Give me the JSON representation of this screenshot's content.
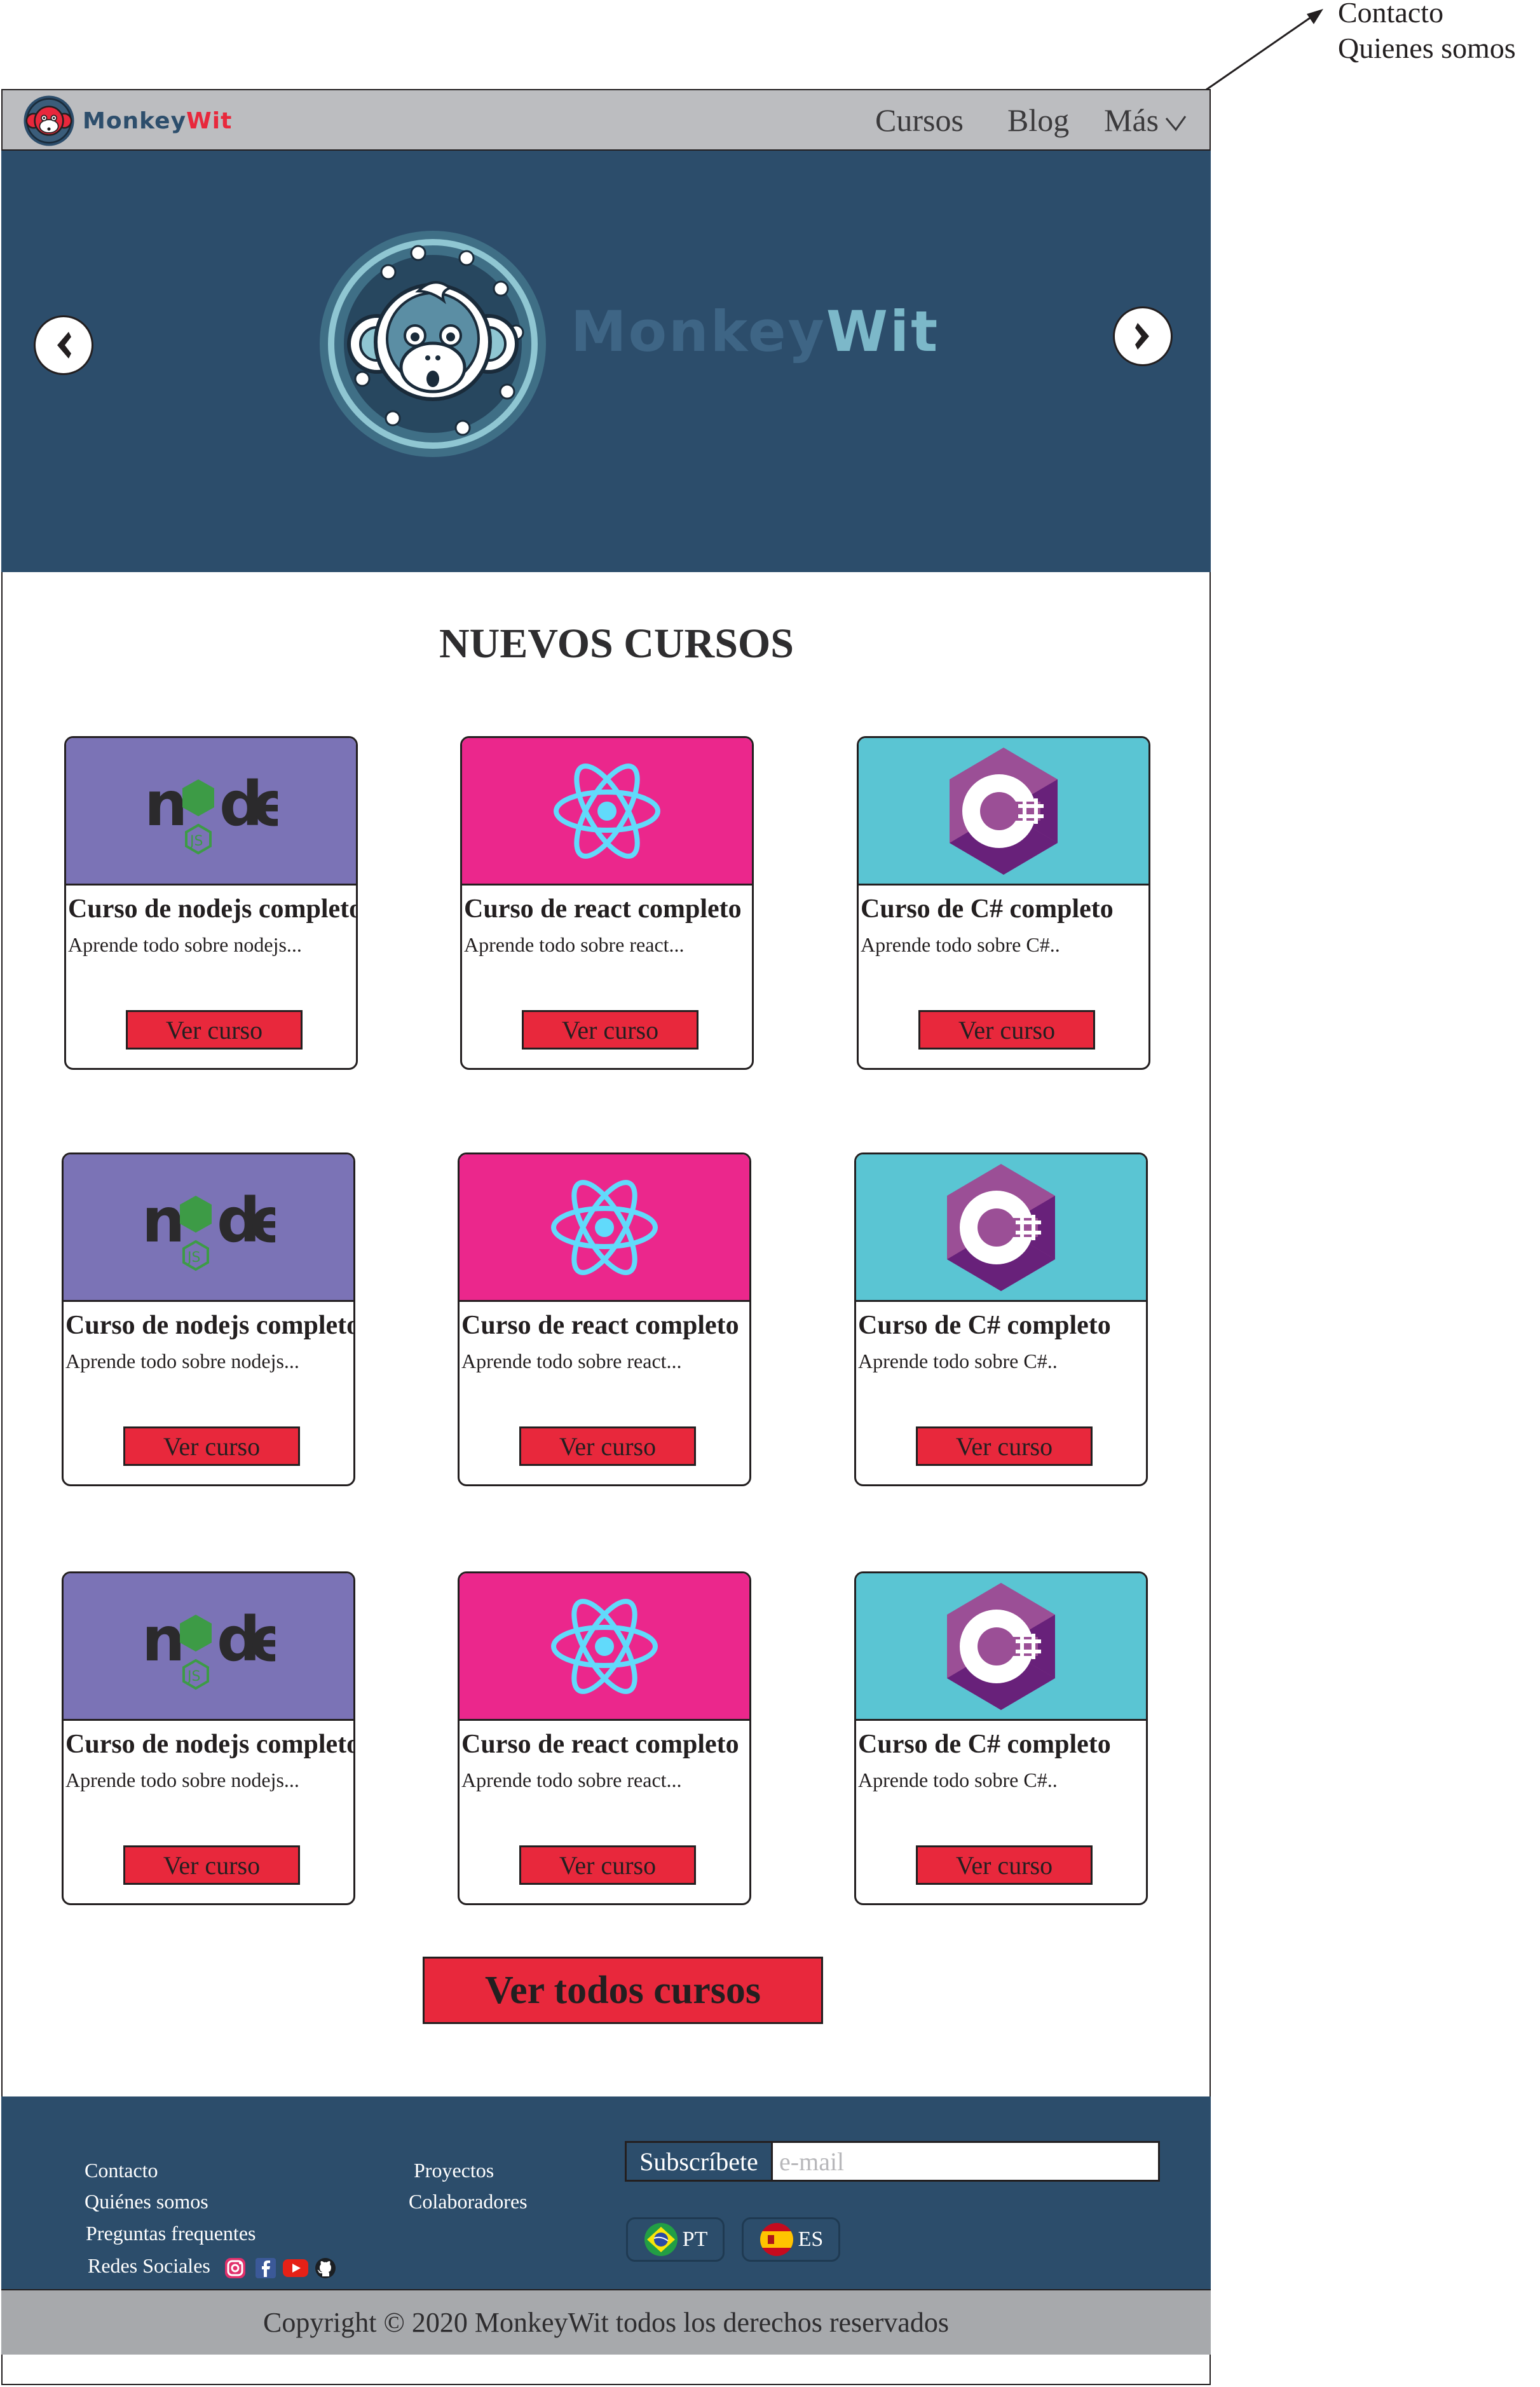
{
  "annotation": {
    "lines": [
      "Contacto",
      "Quienes somos"
    ]
  },
  "navbar": {
    "brand_part1": "Monkey",
    "brand_part2": "Wit",
    "links": [
      "Cursos",
      "Blog",
      "Más"
    ]
  },
  "hero": {
    "brand_part1": "Monkey",
    "brand_part2": "Wit",
    "prev_icon": "chevron-left-icon",
    "next_icon": "chevron-right-icon"
  },
  "section_title": "NUEVOS CURSOS",
  "courses": [
    {
      "title": "Curso de nodejs completo",
      "desc": "Aprende todo sobre nodejs...",
      "button": "Ver curso",
      "logo": "nodejs-logo",
      "color": "#7b73b6"
    },
    {
      "title": "Curso de react completo",
      "desc": "Aprende todo sobre react...",
      "button": "Ver curso",
      "logo": "react-logo",
      "color": "#eb278c"
    },
    {
      "title": "Curso de C# completo",
      "desc": "Aprende todo sobre C#..",
      "button": "Ver curso",
      "logo": "csharp-logo",
      "color": "#5ac5d3"
    },
    {
      "title": "Curso de nodejs completo",
      "desc": "Aprende todo sobre nodejs...",
      "button": "Ver curso",
      "logo": "nodejs-logo",
      "color": "#7b73b6"
    },
    {
      "title": "Curso de react completo",
      "desc": "Aprende todo sobre react...",
      "button": "Ver curso",
      "logo": "react-logo",
      "color": "#eb278c"
    },
    {
      "title": "Curso de C# completo",
      "desc": "Aprende todo sobre C#..",
      "button": "Ver curso",
      "logo": "csharp-logo",
      "color": "#5ac5d3"
    },
    {
      "title": "Curso de nodejs completo",
      "desc": "Aprende todo sobre nodejs...",
      "button": "Ver curso",
      "logo": "nodejs-logo",
      "color": "#7b73b6"
    },
    {
      "title": "Curso de react completo",
      "desc": "Aprende todo sobre react...",
      "button": "Ver curso",
      "logo": "react-logo",
      "color": "#eb278c"
    },
    {
      "title": "Curso de C# completo",
      "desc": "Aprende todo sobre C#..",
      "button": "Ver curso",
      "logo": "csharp-logo",
      "color": "#5ac5d3"
    }
  ],
  "all_courses_button": "Ver todos cursos",
  "footer": {
    "col1": [
      "Contacto",
      "Quiénes somos",
      "Preguntas frequentes",
      "Redes Sociales"
    ],
    "col2": [
      "Proyectos",
      "Colaboradores"
    ],
    "social_icons": [
      "instagram-icon",
      "facebook-icon",
      "youtube-icon",
      "github-icon"
    ],
    "subscribe_label": "Subscríbete",
    "email_placeholder": "e-mail",
    "languages": [
      {
        "code": "PT",
        "flag": "brazil-flag-icon"
      },
      {
        "code": "ES",
        "flag": "spain-flag-icon"
      }
    ],
    "copyright": "Copyright © 2020 MonkeyWit todos los derechos reservados"
  },
  "colors": {
    "navbar_bg": "#bcbdc0",
    "hero_bg": "#2c4d6b",
    "accent_red": "#e8283c",
    "copyright_bg": "#a7a9ac"
  }
}
